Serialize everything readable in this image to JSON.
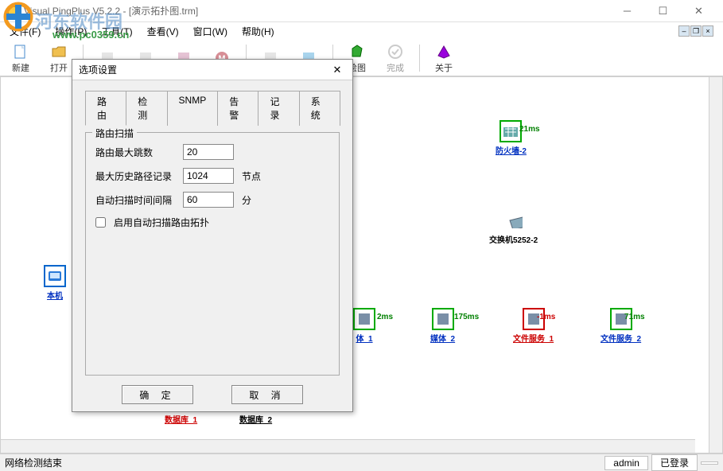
{
  "window": {
    "title": "Visual PingPlus V5.2.2 - [演示拓扑图.trm]"
  },
  "menu": {
    "file": "文件(F)",
    "op": "操作(P)",
    "tool": "工具(T)",
    "view": "查看(V)",
    "window": "窗口(W)",
    "help": "帮助(H)"
  },
  "watermark": {
    "brand": "河东软件园",
    "url": "www.pc0359.cn"
  },
  "toolbar": {
    "new": "新建",
    "open": "打开",
    "t3": "",
    "t4": "",
    "t5": "",
    "t6": "",
    "t7": "",
    "t8": "",
    "t9": "",
    "draw": "绘图",
    "done": "完成",
    "about": "关于"
  },
  "dialog": {
    "title": "选项设置",
    "tabs": {
      "route": "路由",
      "detect": "检测",
      "snmp": "SNMP",
      "alarm": "告警",
      "record": "记录",
      "system": "系统"
    },
    "groupTitle": "路由扫描",
    "maxHopsLabel": "路由最大跳数",
    "maxHops": "20",
    "maxHistLabel": "最大历史路径记录",
    "maxHist": "1024",
    "histUnit": "节点",
    "intervalLabel": "自动扫描时间间隔",
    "interval": "60",
    "intervalUnit": "分",
    "autoScanLabel": "启用自动扫描路由拓扑",
    "ok": "确 定",
    "cancel": "取 消"
  },
  "nodes": {
    "local": {
      "label": "本机"
    },
    "firewall": {
      "label": "防火墙-2",
      "ping": "21ms"
    },
    "switch": {
      "label": "交换机5252-2"
    },
    "media1": {
      "label": "体_1",
      "ping": "2ms"
    },
    "media2": {
      "label": "媒体_2",
      "ping": "175ms"
    },
    "file1": {
      "label": "文件服务_1",
      "ping": "-1ms"
    },
    "file2": {
      "label": "文件服务_2",
      "ping": "71ms"
    },
    "db1": {
      "label": "数据库_1"
    },
    "db2": {
      "label": "数据库_2"
    }
  },
  "status": {
    "msg": "网络检测结束",
    "user": "admin",
    "login": "已登录"
  }
}
